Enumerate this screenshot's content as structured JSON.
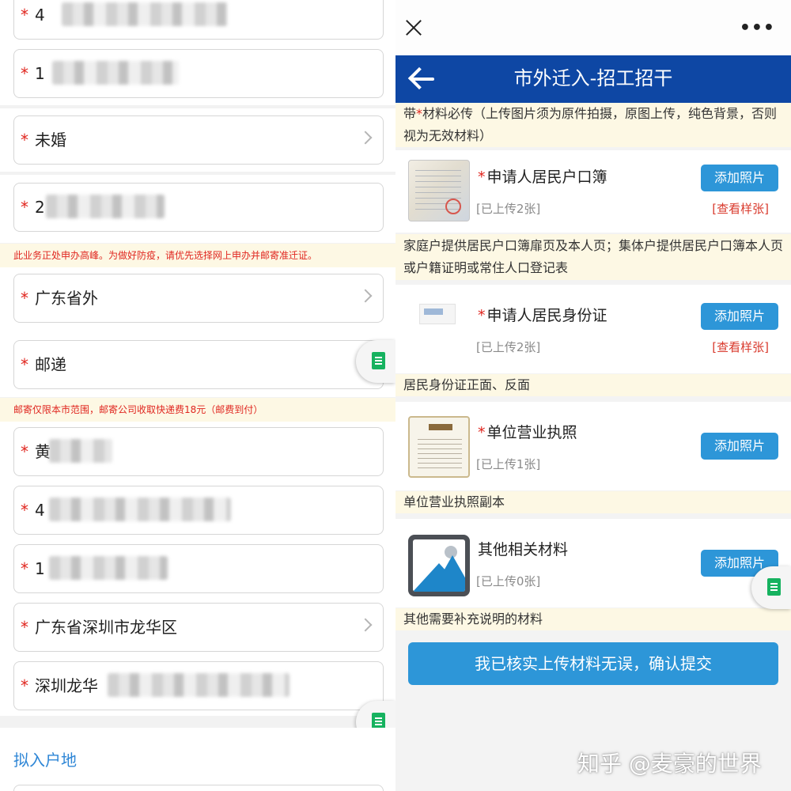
{
  "left_form": {
    "fields": [
      {
        "value": "未婚"
      },
      {
        "value": "广东省外"
      },
      {
        "value": "邮递"
      },
      {
        "value": "广东省深圳市龙华区"
      },
      {
        "value": "深圳龙华"
      }
    ],
    "partial_fields": [
      {
        "visible": "4"
      },
      {
        "visible": "1"
      },
      {
        "visible": "2"
      },
      {
        "visible": "黄"
      },
      {
        "visible": "4"
      },
      {
        "visible": "1"
      }
    ],
    "notice_pandemic": "此业务正处申办高峰。为做好防疫，请优先选择网上申办并邮寄准迁证。",
    "notice_postal": "邮寄仅限本市范围，邮寄公司收取快递费18元（邮费到付）",
    "section_title": "拟入户地",
    "required_mark": "*"
  },
  "right_app": {
    "more_icon": "•••",
    "title": "市外迁入-招工招干",
    "intro": {
      "prefix": "带",
      "star": "*",
      "text": "材料必传（上传图片须为原件拍摄，原图上传，纯色背景，否则视为无效材料）"
    },
    "materials": [
      {
        "title": "申请人居民户口簿",
        "required": true,
        "status": "[已上传2张]",
        "button": "添加照片",
        "sample": "[查看样张]",
        "note": "家庭户提供居民户口簿扉页及本人页；集体户提供居民户口簿本人页或户籍证明或常住人口登记表",
        "thumb": "household-register-photo"
      },
      {
        "title": "申请人居民身份证",
        "required": true,
        "status": "[已上传2张]",
        "button": "添加照片",
        "sample": "[查看样张]",
        "note": "居民身份证正面、反面",
        "thumb": "id-card-photo"
      },
      {
        "title": "单位营业执照",
        "required": true,
        "status": "[已上传1张]",
        "button": "添加照片",
        "note": "单位营业执照副本",
        "thumb": "business-license-photo"
      },
      {
        "title": "其他相关材料",
        "required": false,
        "status": "[已上传0张]",
        "button": "添加照片",
        "note": "其他需要补充说明的材料",
        "thumb": "image-placeholder-icon"
      }
    ],
    "submit": "我已核实上传材料无误，确认提交",
    "watermark": "知乎 @麦豪的世界"
  },
  "colors": {
    "header_blue": "#0e47a4",
    "button_blue": "#2d96d8",
    "required_red": "#e0261f",
    "notice_bg": "#fdf8e4",
    "link_blue": "#2e86d6"
  }
}
